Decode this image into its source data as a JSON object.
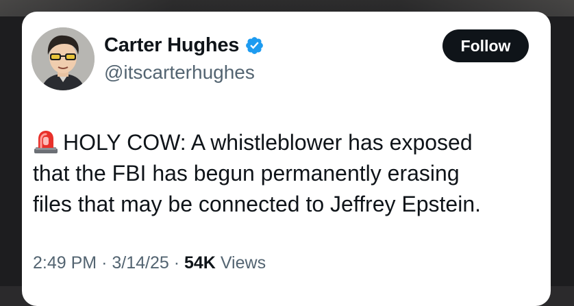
{
  "author": {
    "display_name": "Carter Hughes",
    "handle": "@itscarterhughes",
    "verified": true,
    "avatar_icon": "avatar-cartoon-man-with-sunglasses"
  },
  "follow_button": {
    "label": "Follow"
  },
  "tweet": {
    "emoji_icon": "police-siren-icon",
    "lines": [
      "HOLY COW: A whistleblower has exposed",
      "that the FBI has begun permanently erasing",
      "files that may be connected to Jeffrey Epstein."
    ]
  },
  "meta": {
    "time": "2:49 PM",
    "sep1": "·",
    "date": "3/14/25",
    "sep2": "·",
    "views_count": "54K",
    "views_label": "Views"
  },
  "colors": {
    "text_primary": "#0f1419",
    "text_secondary": "#536471",
    "verified_blue": "#1d9bf0",
    "button_bg": "#0f1419"
  }
}
